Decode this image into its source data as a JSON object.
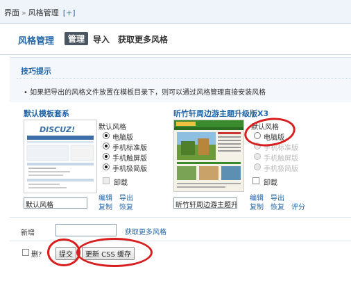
{
  "breadcrumb": {
    "root": "界面",
    "separator": "»",
    "current": "风格管理",
    "add": "[+]"
  },
  "header": {
    "title": "风格管理",
    "tabs": [
      "管理",
      "导入",
      "获取更多风格"
    ]
  },
  "tips": {
    "title": "技巧提示",
    "text": "如果把导出的风格文件放置在模板目录下，则可以通过风格管理直接安装风格"
  },
  "themes": [
    {
      "title": "默认模板套系",
      "group_label": "默认风格",
      "options": [
        "电脑版",
        "手机标准版",
        "手机触屏版",
        "手机极简版"
      ],
      "uninstall": "卸载",
      "name_value": "默认风格",
      "actions": [
        "编辑",
        "导出",
        "复制",
        "恢复"
      ],
      "thumb_brand": "DISCUZ!"
    },
    {
      "title": "昕竹轩周边游主题升级版X3",
      "group_label": "默认风格",
      "options": [
        "电脑版",
        "手机标准版",
        "手机触屏版",
        "手机极简版"
      ],
      "uninstall": "卸载",
      "name_value": "昕竹轩周边游主题升级版",
      "actions": [
        "编辑",
        "导出",
        "复制",
        "恢复",
        "评分"
      ]
    }
  ],
  "add": {
    "label": "新增",
    "value": "",
    "link": "获取更多风格"
  },
  "footer": {
    "delete_label": "删?",
    "submit_label": "提交",
    "update_css_label": "更新 CSS 缓存"
  },
  "colors": {
    "accent": "#2366a8",
    "annotation": "#d81e1e",
    "active_tab": "#4a5663"
  }
}
